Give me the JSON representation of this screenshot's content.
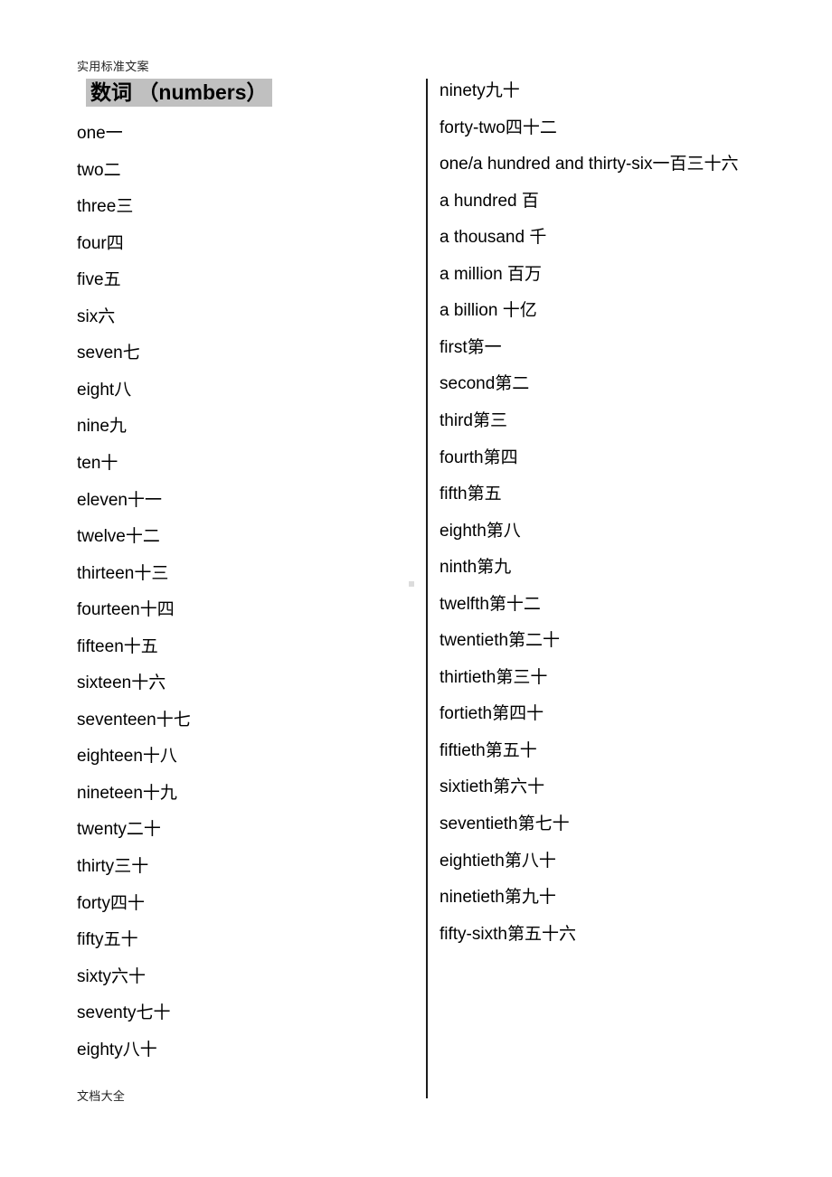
{
  "page": {
    "running_head": "实用标准文案",
    "running_foot": "文档大全",
    "title": "数词 （numbers）",
    "highlight_color": "#c0c0c0",
    "divider_color": "#1b1b1b",
    "background": "#ffffff"
  },
  "columns": {
    "left": {
      "entries": [
        {
          "en": "one",
          "cn": "一"
        },
        {
          "en": "two",
          "cn": "二"
        },
        {
          "en": "three",
          "cn": "三"
        },
        {
          "en": "four",
          "cn": "四"
        },
        {
          "en": "five",
          "cn": "五"
        },
        {
          "en": "six",
          "cn": "六"
        },
        {
          "en": "seven",
          "cn": "七"
        },
        {
          "en": "eight",
          "cn": "八"
        },
        {
          "en": "nine",
          "cn": "九"
        },
        {
          "en": "ten",
          "cn": "十"
        },
        {
          "en": "eleven",
          "cn": "十一"
        },
        {
          "en": "twelve",
          "cn": "十二"
        },
        {
          "en": "thirteen",
          "cn": "十三"
        },
        {
          "en": "fourteen",
          "cn": "十四"
        },
        {
          "en": "fifteen",
          "cn": "十五"
        },
        {
          "en": "sixteen",
          "cn": "十六"
        },
        {
          "en": "seventeen",
          "cn": "十七"
        },
        {
          "en": "eighteen",
          "cn": "十八"
        },
        {
          "en": "nineteen",
          "cn": "十九"
        },
        {
          "en": "twenty",
          "cn": "二十"
        },
        {
          "en": "thirty",
          "cn": "三十"
        },
        {
          "en": "forty",
          "cn": "四十"
        },
        {
          "en": "fifty",
          "cn": "五十"
        },
        {
          "en": "sixty",
          "cn": "六十"
        },
        {
          "en": "seventy",
          "cn": "七十"
        },
        {
          "en": "eighty",
          "cn": "八十"
        }
      ]
    },
    "right": {
      "entries": [
        {
          "en": "ninety",
          "cn": "九十"
        },
        {
          "en": "forty-two",
          "cn": "四十二"
        },
        {
          "en": "one/a hundred and thirty-six",
          "cn": "一百三十六"
        },
        {
          "en": "a hundred ",
          "cn": "百"
        },
        {
          "en": "a thousand ",
          "cn": "千"
        },
        {
          "en": "a million ",
          "cn": "百万"
        },
        {
          "en": "a billion ",
          "cn": "十亿"
        },
        {
          "en": "first",
          "cn": "第一"
        },
        {
          "en": "second",
          "cn": "第二"
        },
        {
          "en": "third",
          "cn": "第三"
        },
        {
          "en": "fourth",
          "cn": "第四"
        },
        {
          "en": "fifth",
          "cn": "第五"
        },
        {
          "en": "eighth",
          "cn": "第八"
        },
        {
          "en": "ninth",
          "cn": "第九"
        },
        {
          "en": "twelfth",
          "cn": "第十二"
        },
        {
          "en": "twentieth",
          "cn": "第二十"
        },
        {
          "en": "thirtieth",
          "cn": "第三十"
        },
        {
          "en": "fortieth",
          "cn": "第四十"
        },
        {
          "en": "fiftieth",
          "cn": "第五十"
        },
        {
          "en": "sixtieth",
          "cn": "第六十"
        },
        {
          "en": "seventieth",
          "cn": "第七十"
        },
        {
          "en": "eightieth",
          "cn": "第八十"
        },
        {
          "en": "ninetieth",
          "cn": "第九十"
        },
        {
          "en": "fifty-sixth",
          "cn": "第五十六"
        }
      ]
    }
  }
}
